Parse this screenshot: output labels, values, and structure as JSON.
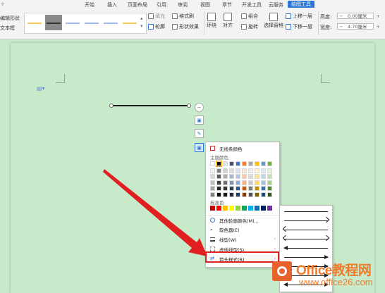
{
  "ribbon": {
    "tabs": [
      "开始",
      "插入",
      "页面布局",
      "引用",
      "审阅",
      "视图",
      "章节",
      "开发工具",
      "云服务",
      "绘图工具"
    ],
    "active_tab_index": 9,
    "left_labels": [
      "编辑形状",
      "文本框"
    ],
    "fill_label": "填充",
    "format_brush_label": "格式刷",
    "outline_label": "轮廓",
    "shape_effect_label": "形状效果",
    "wrap_label": "环绕",
    "align_label": "对齐",
    "group_label": "组合",
    "rotate_label": "旋转",
    "select_pane_label": "选择窗格",
    "bring_forward_label": "上移一层",
    "send_backward_label": "下移一层",
    "height_label": "高度:",
    "width_label": "宽度:",
    "height_value": "0.00厘米",
    "width_value": "4.70厘米"
  },
  "menu": {
    "no_line_color": "无线条颜色",
    "theme_colors_label": "主题颜色",
    "standard_colors_label": "标准色",
    "more_colors": "其他轮廓颜色(M)...",
    "eyedropper": "取色器(E)",
    "line_style": "线型(W)",
    "dash_style": "虚线线型(S)",
    "arrow_style": "箭头样式(R)"
  },
  "theme_colors": [
    [
      "#ffffff",
      "#000000",
      "#e7e6e6",
      "#44546a",
      "#4472c4",
      "#ed7d31",
      "#a5a5a5",
      "#ffc000",
      "#5b9bd5",
      "#70ad47"
    ],
    [
      "#f2f2f2",
      "#7f7f7f",
      "#d0cece",
      "#d6dce4",
      "#d9e2f3",
      "#fbe5d5",
      "#ededed",
      "#fff2cc",
      "#deebf6",
      "#e2efd9"
    ],
    [
      "#d8d8d8",
      "#595959",
      "#aeabab",
      "#adb9ca",
      "#b4c6e7",
      "#f7cbac",
      "#dbdbdb",
      "#fee599",
      "#bdd7ee",
      "#c5e0b3"
    ],
    [
      "#bfbfbf",
      "#3f3f3f",
      "#757070",
      "#8496b0",
      "#8eaadb",
      "#f4b183",
      "#c9c9c9",
      "#ffd965",
      "#9dc3e6",
      "#a8d08d"
    ],
    [
      "#a5a5a5",
      "#262626",
      "#3a3838",
      "#323f4f",
      "#2f5496",
      "#c55a11",
      "#7b7b7b",
      "#bf9000",
      "#2e75b5",
      "#538135"
    ],
    [
      "#7f7f7f",
      "#0c0c0c",
      "#171616",
      "#222a35",
      "#1f3864",
      "#833c0b",
      "#525252",
      "#7f6000",
      "#1f4e79",
      "#375623"
    ]
  ],
  "standard_colors": [
    "#c00000",
    "#ff0000",
    "#ffc000",
    "#ffff00",
    "#92d050",
    "#00b050",
    "#00b0f0",
    "#0070c0",
    "#002060",
    "#7030a0"
  ],
  "watermark": {
    "title": "Office教程网",
    "url": "www.office26.com"
  }
}
